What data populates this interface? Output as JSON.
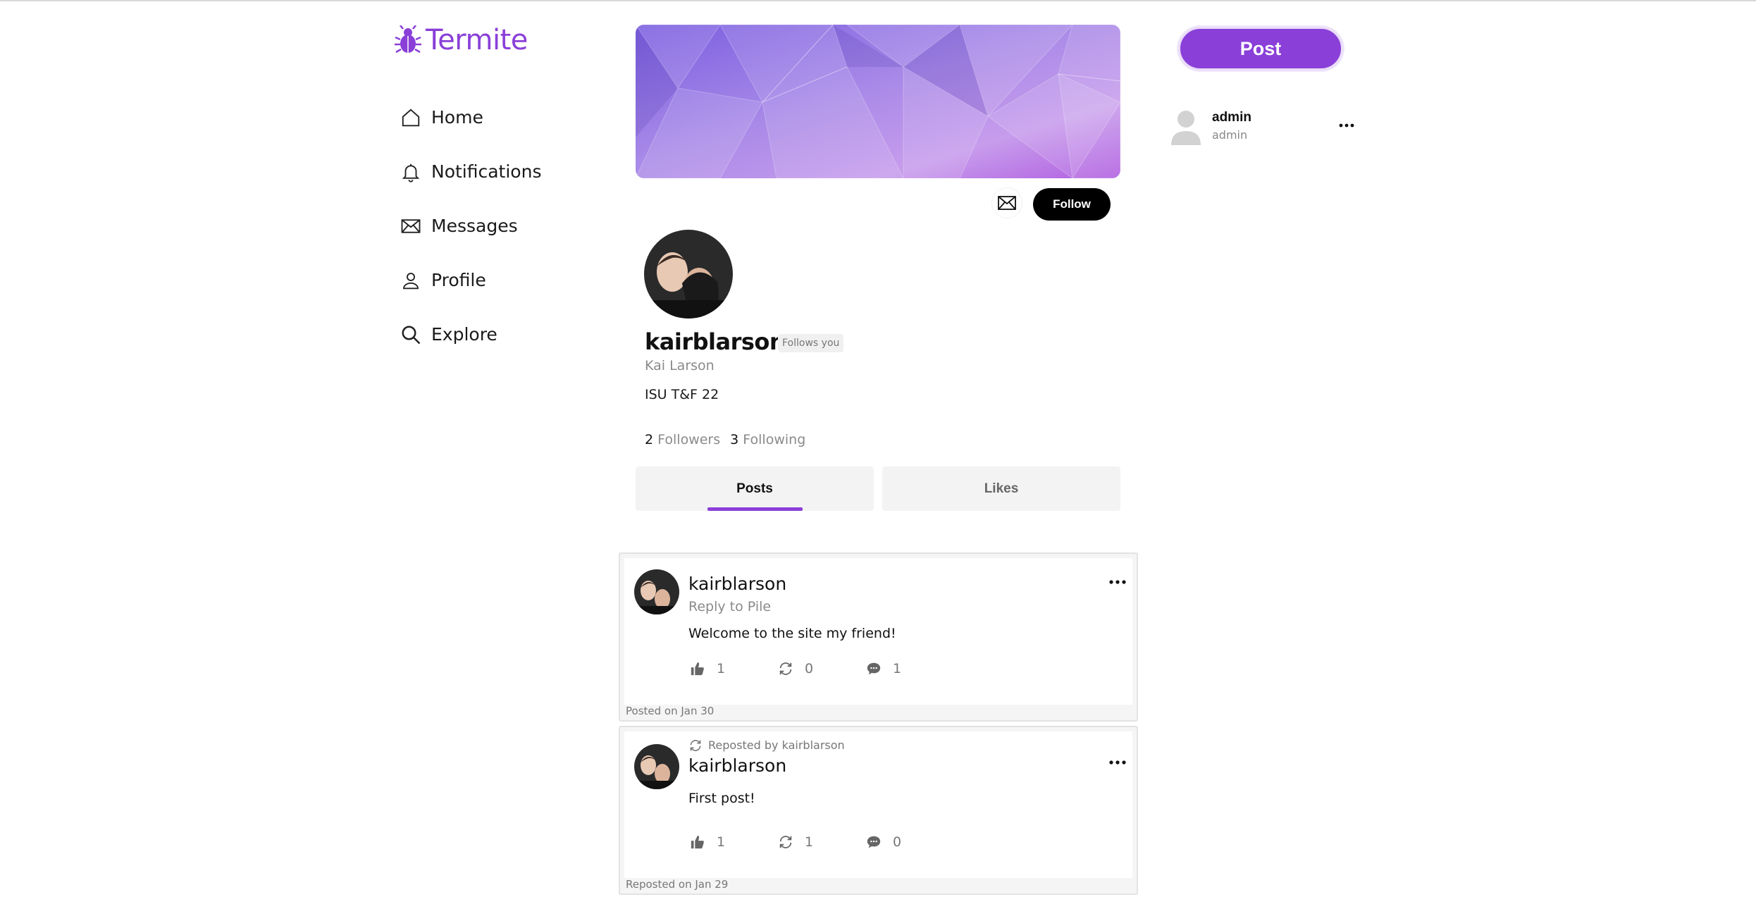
{
  "app": {
    "name": "Termite",
    "accent": "#8a3fd8"
  },
  "nav": {
    "items": [
      {
        "label": "Home",
        "icon": "home-icon"
      },
      {
        "label": "Notifications",
        "icon": "bell-icon"
      },
      {
        "label": "Messages",
        "icon": "envelope-icon"
      },
      {
        "label": "Profile",
        "icon": "person-icon"
      },
      {
        "label": "Explore",
        "icon": "search-icon"
      }
    ]
  },
  "profile": {
    "username": "kairblarson",
    "follows_badge": "Follows you",
    "full_name": "Kai Larson",
    "bio": "ISU T&F 22",
    "followers_count": "2",
    "followers_label": "Followers",
    "following_count": "3",
    "following_label": "Following",
    "follow_button": "Follow"
  },
  "tabs": [
    {
      "label": "Posts",
      "active": true
    },
    {
      "label": "Likes",
      "active": false
    }
  ],
  "posts": [
    {
      "username": "kairblarson",
      "reply_to": "Reply to Pile",
      "body": "Welcome to the site my friend!",
      "likes": "1",
      "reposts": "0",
      "comments": "1",
      "footer": "Posted on Jan 30"
    },
    {
      "repost_note": "Reposted by kairblarson",
      "username": "kairblarson",
      "body": "First post!",
      "likes": "1",
      "reposts": "1",
      "comments": "0",
      "footer": "Reposted on Jan 29"
    }
  ],
  "sidebar_right": {
    "post_button": "Post",
    "account_name": "admin",
    "account_handle": "admin"
  }
}
